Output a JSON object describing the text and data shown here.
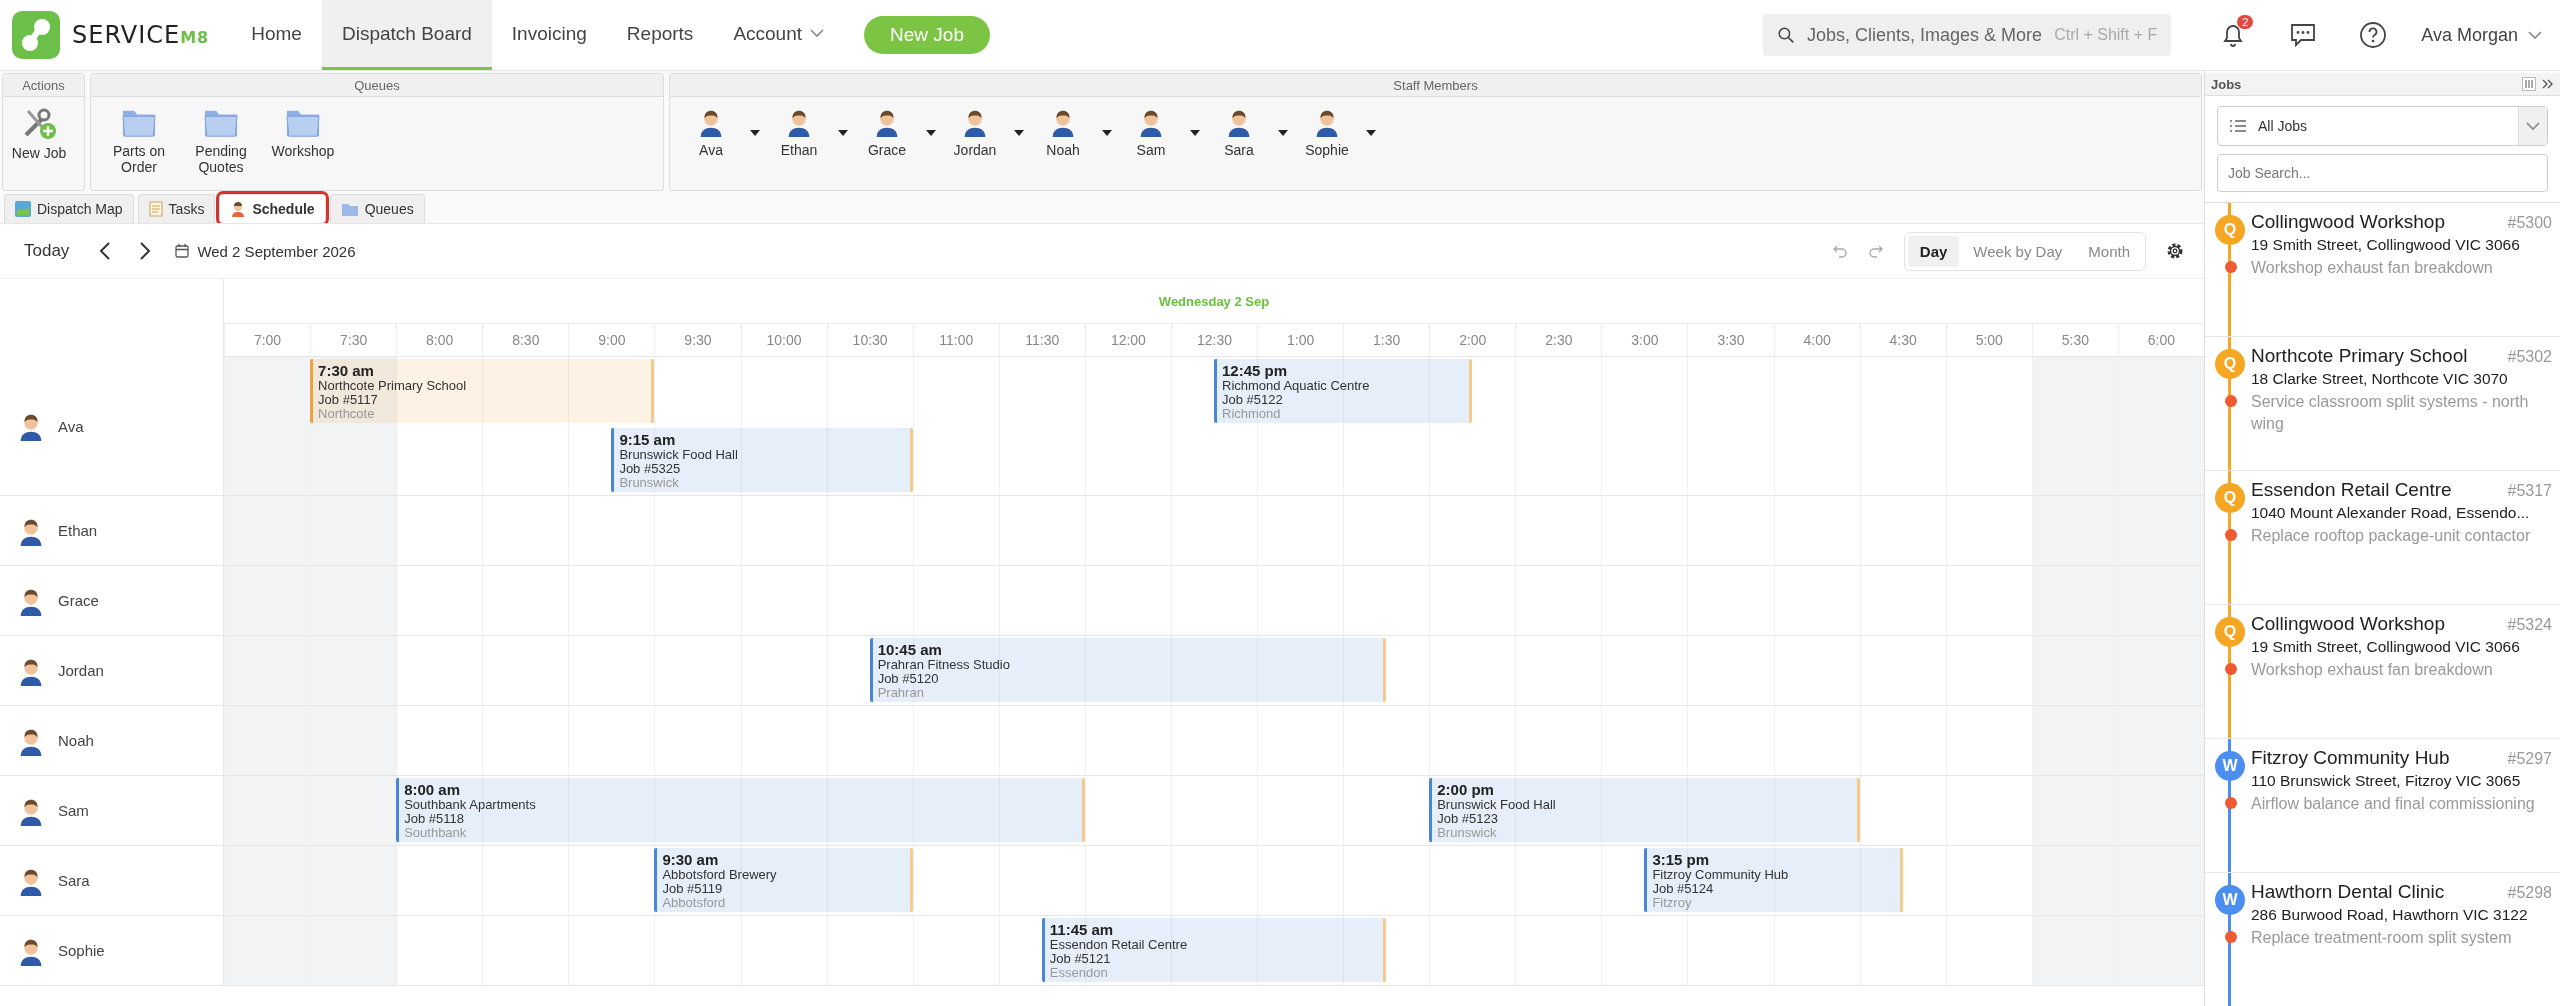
{
  "nav": {
    "logo": {
      "text": "SERVICE",
      "suffix": "M8"
    },
    "items": [
      {
        "label": "Home",
        "selected": false,
        "dropdown": false
      },
      {
        "label": "Dispatch Board",
        "selected": true,
        "dropdown": false
      },
      {
        "label": "Invoicing",
        "selected": false,
        "dropdown": false
      },
      {
        "label": "Reports",
        "selected": false,
        "dropdown": false
      },
      {
        "label": "Account",
        "selected": false,
        "dropdown": true
      }
    ],
    "new_job": "New Job",
    "search": {
      "placeholder": "Jobs, Clients, Images & More",
      "shortcut": "Ctrl + Shift + F"
    },
    "notifications": "2",
    "user": "Ava Morgan"
  },
  "toolbar": {
    "actions": {
      "title": "Actions",
      "items": [
        "New Job"
      ]
    },
    "queues": {
      "title": "Queues",
      "items": [
        "Parts on Order",
        "Pending Quotes",
        "Workshop"
      ]
    },
    "staff": {
      "title": "Staff Members",
      "items": [
        "Ava",
        "Ethan",
        "Grace",
        "Jordan",
        "Noah",
        "Sam",
        "Sara",
        "Sophie"
      ]
    }
  },
  "tabs": [
    {
      "label": "Dispatch Map",
      "selected": false
    },
    {
      "label": "Tasks",
      "selected": false
    },
    {
      "label": "Schedule",
      "selected": true
    },
    {
      "label": "Queues",
      "selected": false
    }
  ],
  "schedule": {
    "today": "Today",
    "date": "Wed 2 September 2026",
    "views": [
      {
        "label": "Day",
        "selected": true
      },
      {
        "label": "Week by Day",
        "selected": false
      },
      {
        "label": "Month",
        "selected": false
      }
    ],
    "day_heading": "Wednesday 2 Sep",
    "times": [
      "7:00",
      "7:30",
      "8:00",
      "8:30",
      "9:00",
      "9:30",
      "10:00",
      "10:30",
      "11:00",
      "11:30",
      "12:00",
      "12:30",
      "1:00",
      "1:30",
      "2:00",
      "2:30",
      "3:00",
      "3:30",
      "4:00",
      "4:30",
      "5:00",
      "5:30",
      "6:00"
    ],
    "rows": [
      {
        "name": "Ava",
        "events": [
          {
            "time": "7:30 am",
            "title": "Northcote Primary School",
            "job": "Job #5117",
            "suburb": "Northcote",
            "color": "#f0a040"
          },
          {
            "time": "12:45 pm",
            "title": "Richmond Aquatic Centre",
            "job": "Job #5122",
            "suburb": "Richmond",
            "color": "#4a86d8"
          },
          {
            "time": "9:15 am",
            "title": "Brunswick Food Hall",
            "job": "Job #5325",
            "suburb": "Brunswick",
            "color": "#4a86d8"
          }
        ]
      },
      {
        "name": "Ethan",
        "events": []
      },
      {
        "name": "Grace",
        "events": []
      },
      {
        "name": "Jordan",
        "events": [
          {
            "time": "10:45 am",
            "title": "Prahran Fitness Studio",
            "job": "Job #5120",
            "suburb": "Prahran",
            "color": "#4a86d8"
          }
        ]
      },
      {
        "name": "Noah",
        "events": []
      },
      {
        "name": "Sam",
        "events": [
          {
            "time": "8:00 am",
            "title": "Southbank Apartments",
            "job": "Job #5118",
            "suburb": "Southbank",
            "color": "#4a86d8"
          },
          {
            "time": "2:00 pm",
            "title": "Brunswick Food Hall",
            "job": "Job #5123",
            "suburb": "Brunswick",
            "color": "#4a86d8"
          }
        ]
      },
      {
        "name": "Sara",
        "events": [
          {
            "time": "9:30 am",
            "title": "Abbotsford Brewery",
            "job": "Job #5119",
            "suburb": "Abbotsford",
            "color": "#4a86d8"
          },
          {
            "time": "3:15 pm",
            "title": "Fitzroy Community Hub",
            "job": "Job #5124",
            "suburb": "Fitzroy",
            "color": "#4a86d8"
          }
        ]
      },
      {
        "name": "Sophie",
        "events": [
          {
            "time": "11:45 am",
            "title": "Essendon Retail Centre",
            "job": "Job #5121",
            "suburb": "Essendon",
            "color": "#4a86d8"
          }
        ]
      }
    ]
  },
  "jobs_panel": {
    "title": "Jobs",
    "filter": "All Jobs",
    "search_placeholder": "Job Search...",
    "jobs": [
      {
        "badge": "Q",
        "color": "#f5a623",
        "title": "Collingwood Workshop",
        "number": "#5300",
        "address": "19 Smith Street, Collingwood VIC 3066",
        "description": "Workshop exhaust fan breakdown"
      },
      {
        "badge": "Q",
        "color": "#f5a623",
        "title": "Northcote Primary School",
        "number": "#5302",
        "address": "18 Clarke Street, Northcote VIC 3070",
        "description": "Service classroom split systems - north wing"
      },
      {
        "badge": "Q",
        "color": "#f5a623",
        "title": "Essendon Retail Centre",
        "number": "#5317",
        "address": "1040 Mount Alexander Road, Essendo...",
        "description": "Replace rooftop package-unit contactor"
      },
      {
        "badge": "Q",
        "color": "#f5a623",
        "title": "Collingwood Workshop",
        "number": "#5324",
        "address": "19 Smith Street, Collingwood VIC 3066",
        "description": "Workshop exhaust fan breakdown"
      },
      {
        "badge": "W",
        "color": "#4a8ef0",
        "title": "Fitzroy Community Hub",
        "number": "#5297",
        "address": "110 Brunswick Street, Fitzroy VIC 3065",
        "description": "Airflow balance and final commissioning"
      },
      {
        "badge": "W",
        "color": "#4a8ef0",
        "title": "Hawthorn Dental Clinic",
        "number": "#5298",
        "address": "286 Burwood Road, Hawthorn VIC 3122",
        "description": "Replace treatment-room split system"
      }
    ]
  }
}
